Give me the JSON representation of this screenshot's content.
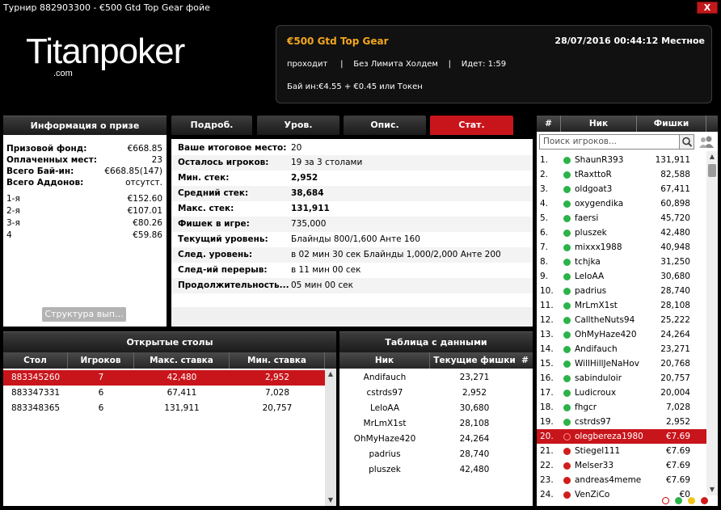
{
  "window": {
    "title": "Турнир 882903300 - €500 Gtd Top Gear фойе",
    "close_label": "X"
  },
  "logo": {
    "text_main": "Titanpoker",
    "text_sub": ".com"
  },
  "tournament": {
    "name": "€500 Gtd Top Gear",
    "datetime": "28/07/2016 00:44:12  Местное",
    "status_line": "проходит     |    Без Лимита Холдем    |    Идет: 1:59",
    "buyin": "Бай ин:€4.55 + €0.45 или Токен"
  },
  "prize": {
    "title": "Информация о призе",
    "summary": [
      {
        "label": "Призовой фонд:",
        "value": "€668.85"
      },
      {
        "label": "Оплаченных мест:",
        "value": "23"
      },
      {
        "label": "Всего Бай-ин:",
        "value": "€668.85(147)"
      },
      {
        "label": "Всего Аддонов:",
        "value": "отсутст."
      }
    ],
    "places": [
      {
        "label": "1-я",
        "value": "€152.60"
      },
      {
        "label": "2-я",
        "value": "€107.01"
      },
      {
        "label": "3-я",
        "value": "€80.26"
      },
      {
        "label": "4",
        "value": "€59.86"
      }
    ],
    "structure_button": "Структура вып..."
  },
  "tabs": [
    {
      "label": "Подроб."
    },
    {
      "label": "Уров."
    },
    {
      "label": "Опис."
    },
    {
      "label": "Стат."
    }
  ],
  "stats": [
    {
      "label": "Ваше итоговое место:",
      "value": "20"
    },
    {
      "label": "Осталось игроков:",
      "value": "19 за 3 столами"
    },
    {
      "label": "Мин. стек:",
      "value": "2,952"
    },
    {
      "label": "Средний стек:",
      "value": "38,684"
    },
    {
      "label": "Макс. стек:",
      "value": "131,911"
    },
    {
      "label": "Фишек в игре:",
      "value": "735,000"
    },
    {
      "label": "Текущий уровень:",
      "value": "Блайнды 800/1,600 Анте 160"
    },
    {
      "label": "След. уровень:",
      "value": "в 02 мин 30 сек  Блайнды 1,000/2,000 Анте 200"
    },
    {
      "label": "След-ий перерыв:",
      "value": "в 11 мин 00 сек"
    },
    {
      "label": "Продолжительность...",
      "value": "05 мин 00 сек"
    }
  ],
  "open_tables": {
    "title": "Открытые столы",
    "columns": [
      "Стол",
      "Игроков",
      "Макс. ставка",
      "Мин. ставка"
    ],
    "rows": [
      [
        "883345260",
        "7",
        "42,480",
        "2,952"
      ],
      [
        "883347331",
        "6",
        "67,411",
        "7,028"
      ],
      [
        "883348365",
        "6",
        "131,911",
        "20,757"
      ]
    ]
  },
  "data_table": {
    "title": "Таблица с данными",
    "columns": [
      "Ник",
      "Текущие фишки",
      "#"
    ],
    "rows": [
      [
        "Andifauch",
        "23,271"
      ],
      [
        "cstrds97",
        "2,952"
      ],
      [
        "LeloAA",
        "30,680"
      ],
      [
        "MrLmX1st",
        "28,108"
      ],
      [
        "OhMyHaze420",
        "24,264"
      ],
      [
        "padrius",
        "28,740"
      ],
      [
        "pluszek",
        "42,480"
      ]
    ]
  },
  "players": {
    "columns": [
      "#",
      "Ник",
      "Фишки"
    ],
    "search_placeholder": "Поиск игроков...",
    "status_colors": {
      "green": "#2bb34a",
      "red": "#d01c1c",
      "grey": "#aaaaaa"
    },
    "rows": [
      [
        "1.",
        "ShaunR393",
        "131,911",
        "green"
      ],
      [
        "2.",
        "tRaxttoR",
        "82,588",
        "green"
      ],
      [
        "3.",
        "oldgoat3",
        "67,411",
        "green"
      ],
      [
        "4.",
        "oxygendika",
        "60,898",
        "green"
      ],
      [
        "5.",
        "faersi",
        "45,720",
        "green"
      ],
      [
        "6.",
        "pluszek",
        "42,480",
        "green"
      ],
      [
        "7.",
        "mixxx1988",
        "40,948",
        "green"
      ],
      [
        "8.",
        "tchjka",
        "31,250",
        "green"
      ],
      [
        "9.",
        "LeloAA",
        "30,680",
        "green"
      ],
      [
        "10.",
        "padrius",
        "28,740",
        "green"
      ],
      [
        "11.",
        "MrLmX1st",
        "28,108",
        "green"
      ],
      [
        "12.",
        "CalltheNuts94",
        "25,222",
        "green"
      ],
      [
        "13.",
        "OhMyHaze420",
        "24,264",
        "green"
      ],
      [
        "14.",
        "Andifauch",
        "23,271",
        "green"
      ],
      [
        "15.",
        "WillHillJeNaHov",
        "20,768",
        "green"
      ],
      [
        "16.",
        "sabinduloir",
        "20,757",
        "green"
      ],
      [
        "17.",
        "Ludicroux",
        "20,004",
        "green"
      ],
      [
        "18.",
        "fhgcr",
        "7,028",
        "green"
      ],
      [
        "19.",
        "cstrds97",
        "2,952",
        "green"
      ],
      [
        "20.",
        "olegbereza1980",
        "€7.69",
        "red"
      ],
      [
        "21.",
        "Stiegel111",
        "€7.69",
        "red"
      ],
      [
        "22.",
        "Melser33",
        "€7.69",
        "red"
      ],
      [
        "23.",
        "andreas4meme",
        "€7.69",
        "red"
      ],
      [
        "24.",
        "VenZiCo",
        "€0",
        "red"
      ]
    ]
  }
}
